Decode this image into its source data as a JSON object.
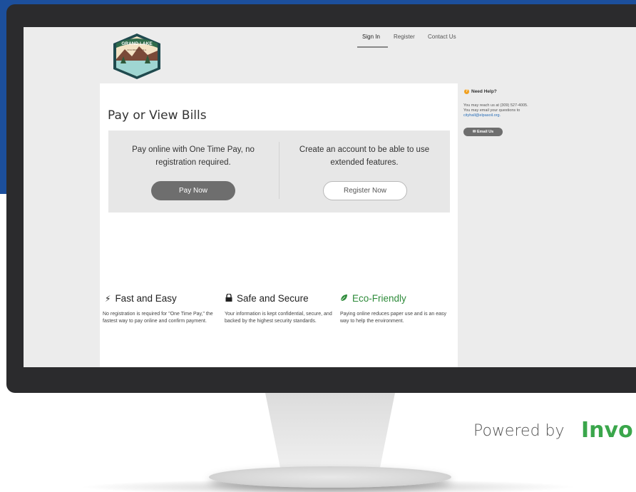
{
  "nav": {
    "sign_in": "Sign In",
    "register": "Register",
    "contact": "Contact Us"
  },
  "logo": {
    "text": "GRAND LAKE",
    "subtext": "COLORADO, U.S.A."
  },
  "main": {
    "title": "Pay or View Bills",
    "pay_panel": {
      "text": "Pay online with One Time Pay, no registration required.",
      "button": "Pay Now"
    },
    "register_panel": {
      "text": "Create an account to be able to use extended features.",
      "button": "Register Now"
    }
  },
  "features": [
    {
      "icon": "lightning-icon",
      "title": "Fast and Easy",
      "text": "No registration is required for \"One Time Pay,\" the fastest way to pay online and confirm payment."
    },
    {
      "icon": "lock-icon",
      "title": "Safe and Secure",
      "text": "Your information is kept confidential, secure, and backed by the highest security standards."
    },
    {
      "icon": "leaf-icon",
      "title": "Eco-Friendly",
      "text": "Paying online reduces paper use and is an easy way to help the environment."
    }
  ],
  "help": {
    "title": "Need Help?",
    "line1": "You may reach us at (309) 527-4005.",
    "line2": "You may email your questions to",
    "email": "cityhall@elpasoil.org.",
    "button": "Email Us"
  },
  "footer": {
    "powered_by": "Powered by",
    "brand": "Invo"
  },
  "colors": {
    "background_blue": "#1c4f9c",
    "brand_green": "#3aa64b",
    "eco_green": "#2e8b3a",
    "button_gray": "#6e6e6e",
    "help_orange": "#f0a020",
    "link_blue": "#2a6fb8"
  }
}
